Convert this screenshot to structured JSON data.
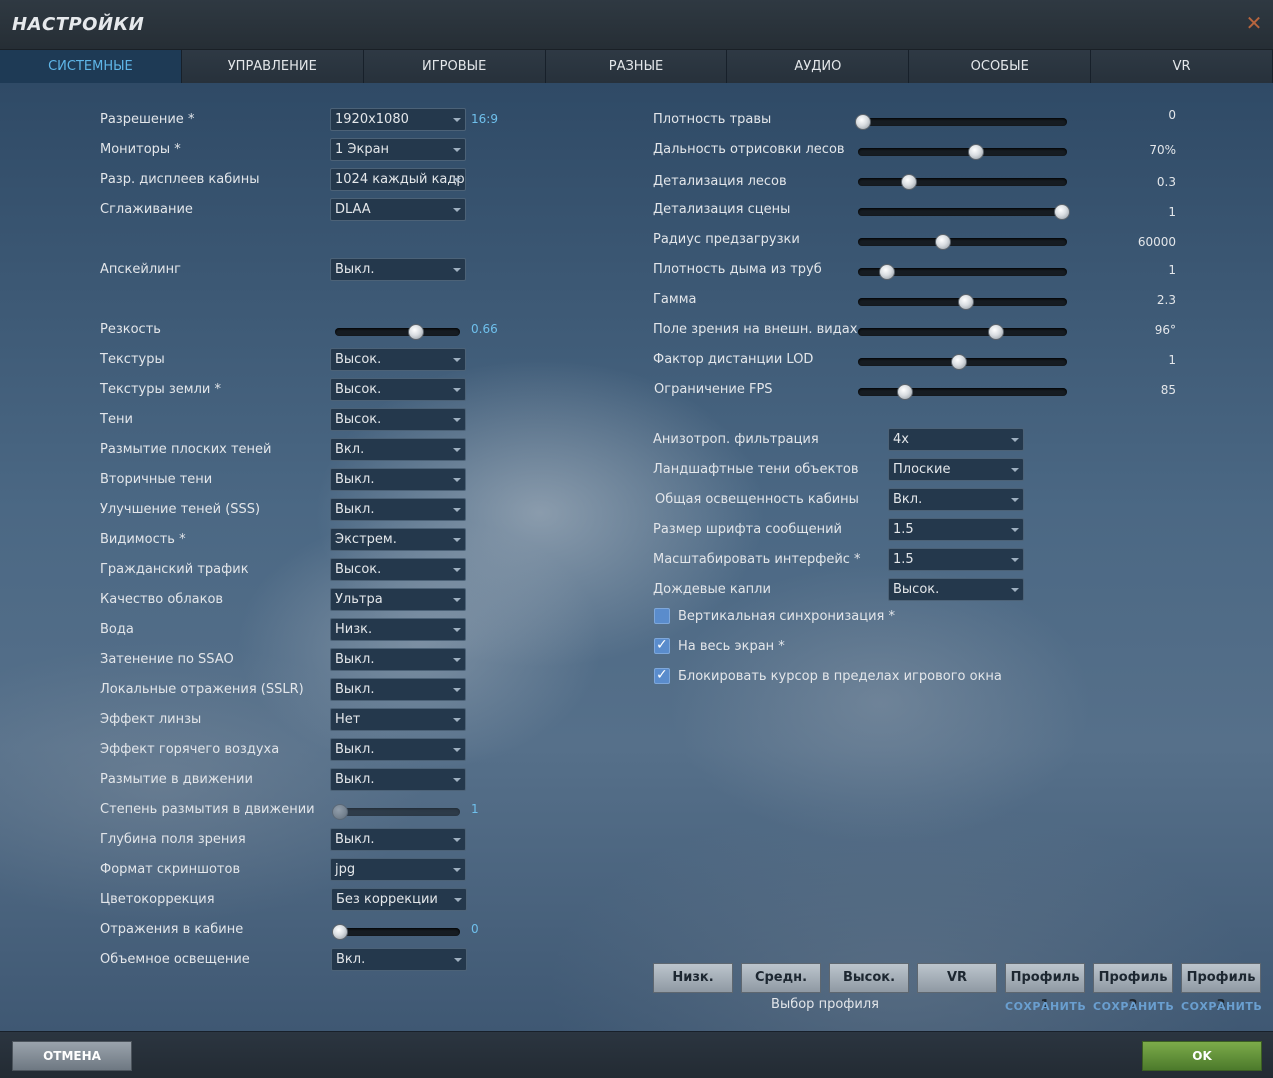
{
  "window": {
    "title": "НАСТРОЙКИ",
    "close_glyph": "✕"
  },
  "tabs": [
    "СИСТЕМНЫЕ",
    "УПРАВЛЕНИЕ",
    "ИГРОВЫЕ",
    "РАЗНЫЕ",
    "АУДИО",
    "ОСОБЫЕ",
    "VR"
  ],
  "active_tab": 0,
  "left": {
    "resolution": {
      "label": "Разрешение *",
      "value": "1920x1080",
      "aspect": "16:9"
    },
    "monitors": {
      "label": "Мониторы *",
      "value": "1 Экран"
    },
    "cockpit_displays": {
      "label": "Разр. дисплеев кабины",
      "value": "1024 каждый кадр"
    },
    "antialiasing": {
      "label": "Сглаживание",
      "value": "DLAA"
    },
    "upscaling": {
      "label": "Апскейлинг",
      "value": "Выкл."
    },
    "sharpness": {
      "label": "Резкость",
      "value": "0.66",
      "fraction": 0.66
    },
    "textures": {
      "label": "Текстуры",
      "value": "Высок."
    },
    "terrain_textures": {
      "label": "Текстуры земли *",
      "value": "Высок."
    },
    "shadows": {
      "label": "Тени",
      "value": "Высок."
    },
    "flat_shadow_blur": {
      "label": "Размытие плоских теней",
      "value": "Вкл."
    },
    "secondary_shadows": {
      "label": "Вторичные тени",
      "value": "Выкл."
    },
    "sss": {
      "label": "Улучшение теней (SSS)",
      "value": "Выкл."
    },
    "visibility": {
      "label": "Видимость *",
      "value": "Экстрем."
    },
    "civil_traffic": {
      "label": "Гражданский трафик",
      "value": "Высок."
    },
    "clouds": {
      "label": "Качество облаков",
      "value": "Ультра"
    },
    "water": {
      "label": "Вода",
      "value": "Низк."
    },
    "ssao": {
      "label": "Затенение по SSAO",
      "value": "Выкл."
    },
    "sslr": {
      "label": "Локальные отражения (SSLR)",
      "value": "Выкл."
    },
    "lens": {
      "label": "Эффект линзы",
      "value": "Нет"
    },
    "heat_blur": {
      "label": "Эффект горячего воздуха",
      "value": "Выкл."
    },
    "motion_blur": {
      "label": "Размытие в движении",
      "value": "Выкл."
    },
    "motion_blur_amount": {
      "label": "Степень размытия в движении",
      "value": "1",
      "fraction": 0.0
    },
    "dof": {
      "label": "Глубина поля зрения",
      "value": "Выкл."
    },
    "screenshot_format": {
      "label": "Формат скриншотов",
      "value": "jpg"
    },
    "color_grading": {
      "label": "Цветокоррекция",
      "value": "Без коррекции"
    },
    "cockpit_reflections": {
      "label": "Отражения в кабине",
      "value": "0",
      "fraction": 0.0
    },
    "volumetric_lighting": {
      "label": "Объемное освещение",
      "value": "Вкл."
    }
  },
  "right": {
    "grass": {
      "label": "Плотность травы",
      "value": "0",
      "fraction": 0.0
    },
    "forest_distance": {
      "label": "Дальность отрисовки лесов",
      "value": "70%",
      "fraction": 0.57
    },
    "forest_detail": {
      "label": "Детализация лесов",
      "value": "0.3",
      "fraction": 0.23
    },
    "scene_detail": {
      "label": "Детализация сцены",
      "value": "1",
      "fraction": 1.0
    },
    "preload_radius": {
      "label": "Радиус предзагрузки",
      "value": "60000",
      "fraction": 0.4
    },
    "chimney_smoke": {
      "label": "Плотность дыма из труб",
      "value": "1",
      "fraction": 0.12
    },
    "gamma": {
      "label": "Гамма",
      "value": "2.3",
      "fraction": 0.52
    },
    "fov": {
      "label": "Поле зрения на внешн. видах",
      "value": "96°",
      "fraction": 0.67
    },
    "lod": {
      "label": "Фактор дистанции LOD",
      "value": "1",
      "fraction": 0.48
    },
    "fps_limit": {
      "label": "Ограничение FPS",
      "value": "85",
      "fraction": 0.21
    },
    "aniso": {
      "label": "Анизотроп. фильтрация",
      "value": "4x"
    },
    "terrain_object_shadows": {
      "label": "Ландшафтные тени объектов",
      "value": "Плоские"
    },
    "cockpit_global_illum": {
      "label": "Общая освещенность кабины",
      "value": "Вкл."
    },
    "message_font": {
      "label": "Размер шрифта сообщений",
      "value": "1.5"
    },
    "ui_scale": {
      "label": "Масштабировать интерфейс *",
      "value": "1.5"
    },
    "rain_drops": {
      "label": "Дождевые капли",
      "value": "Высок."
    },
    "vsync": {
      "label": "Вертикальная синхронизация *",
      "checked": false
    },
    "fullscreen": {
      "label": "На весь экран *",
      "checked": true
    },
    "lock_cursor": {
      "label": "Блокировать курсор в пределах игрового окна",
      "checked": true
    }
  },
  "presets": {
    "buttons": [
      "Низк.",
      "Средн.",
      "Высок.",
      "VR",
      "Профиль 1",
      "Профиль 2",
      "Профиль 3"
    ],
    "save_label": "СОХРАНИТЬ",
    "caption": "Выбор профиля"
  },
  "footer": {
    "cancel": "ОТМЕНА",
    "ok": "OK"
  },
  "colors": {
    "accent": "#5fb6e8",
    "ok_green": "#6a9a3e",
    "checkbox": "#5a8ccc"
  }
}
